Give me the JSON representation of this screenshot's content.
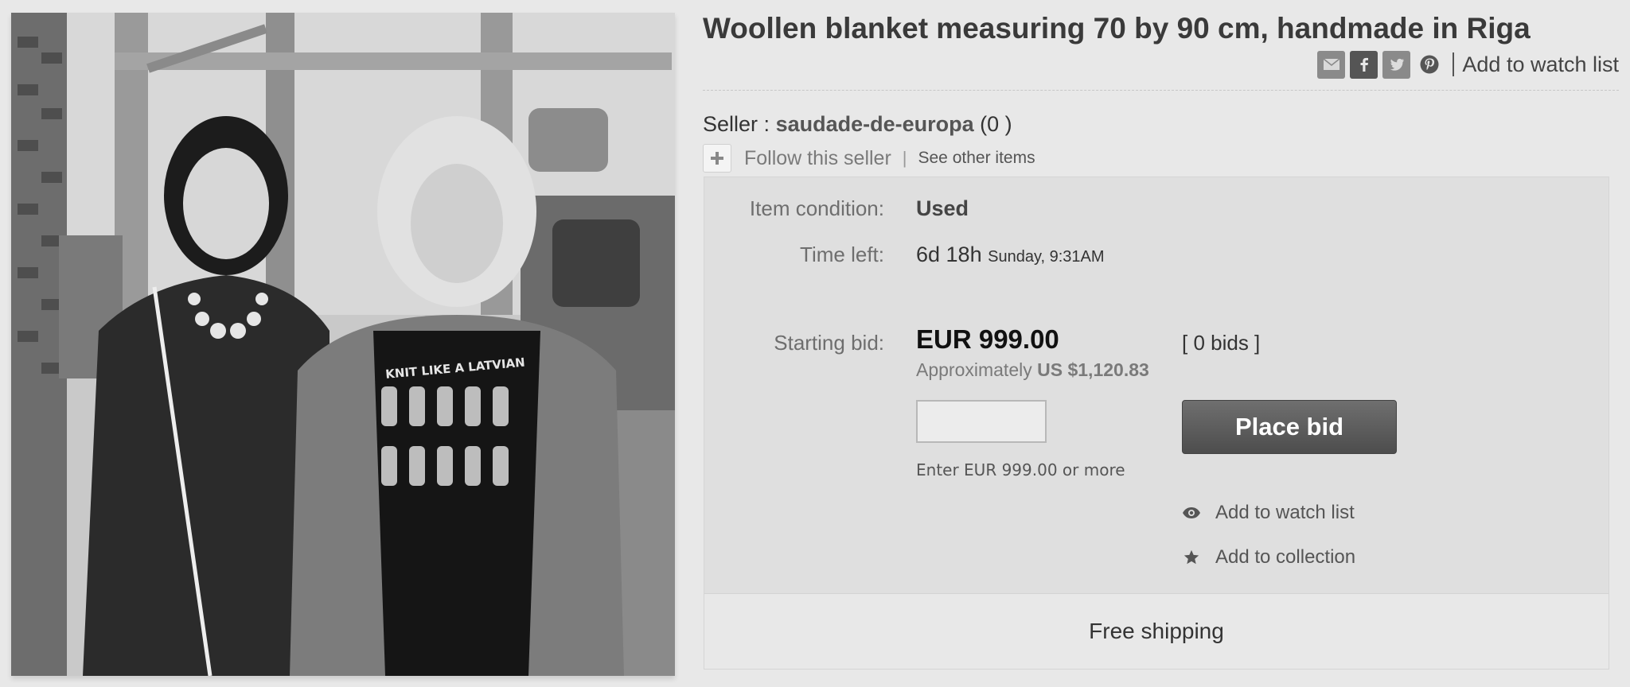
{
  "listing": {
    "title": "Woollen blanket measuring 70 by 90 cm, handmade in Riga",
    "photo_shirt_text": "KNIT LIKE A LATVIAN"
  },
  "share": {
    "icons": [
      "mail-icon",
      "facebook-icon",
      "twitter-icon",
      "pinterest-icon"
    ],
    "watch_label": "Add to watch list"
  },
  "seller": {
    "prefix": "Seller :",
    "name": "saudade-de-europa",
    "feedback": "(0 )",
    "follow_label": "Follow this seller",
    "separator": "|",
    "see_other_label": "See other items"
  },
  "item": {
    "condition_label": "Item condition:",
    "condition_value": "Used",
    "time_left_label": "Time left:",
    "time_left_value": "6d 18h",
    "time_left_end": "Sunday, 9:31AM",
    "starting_bid_label": "Starting bid:",
    "price": "EUR 999.00",
    "bid_count": "[ 0 bids ]",
    "approx_prefix": "Approximately",
    "approx_value": "US $1,120.83",
    "bid_input_value": "",
    "place_bid_label": "Place bid",
    "bid_hint": "Enter EUR 999.00 or more",
    "watch_label": "Add to watch list",
    "collection_label": "Add to collection",
    "shipping": "Free shipping"
  },
  "colors": {
    "page_bg": "#e8e8e8",
    "panel_bg": "#dfdfdf",
    "button_bg": "#5a5a5a",
    "title_text": "#3a3a3a"
  }
}
